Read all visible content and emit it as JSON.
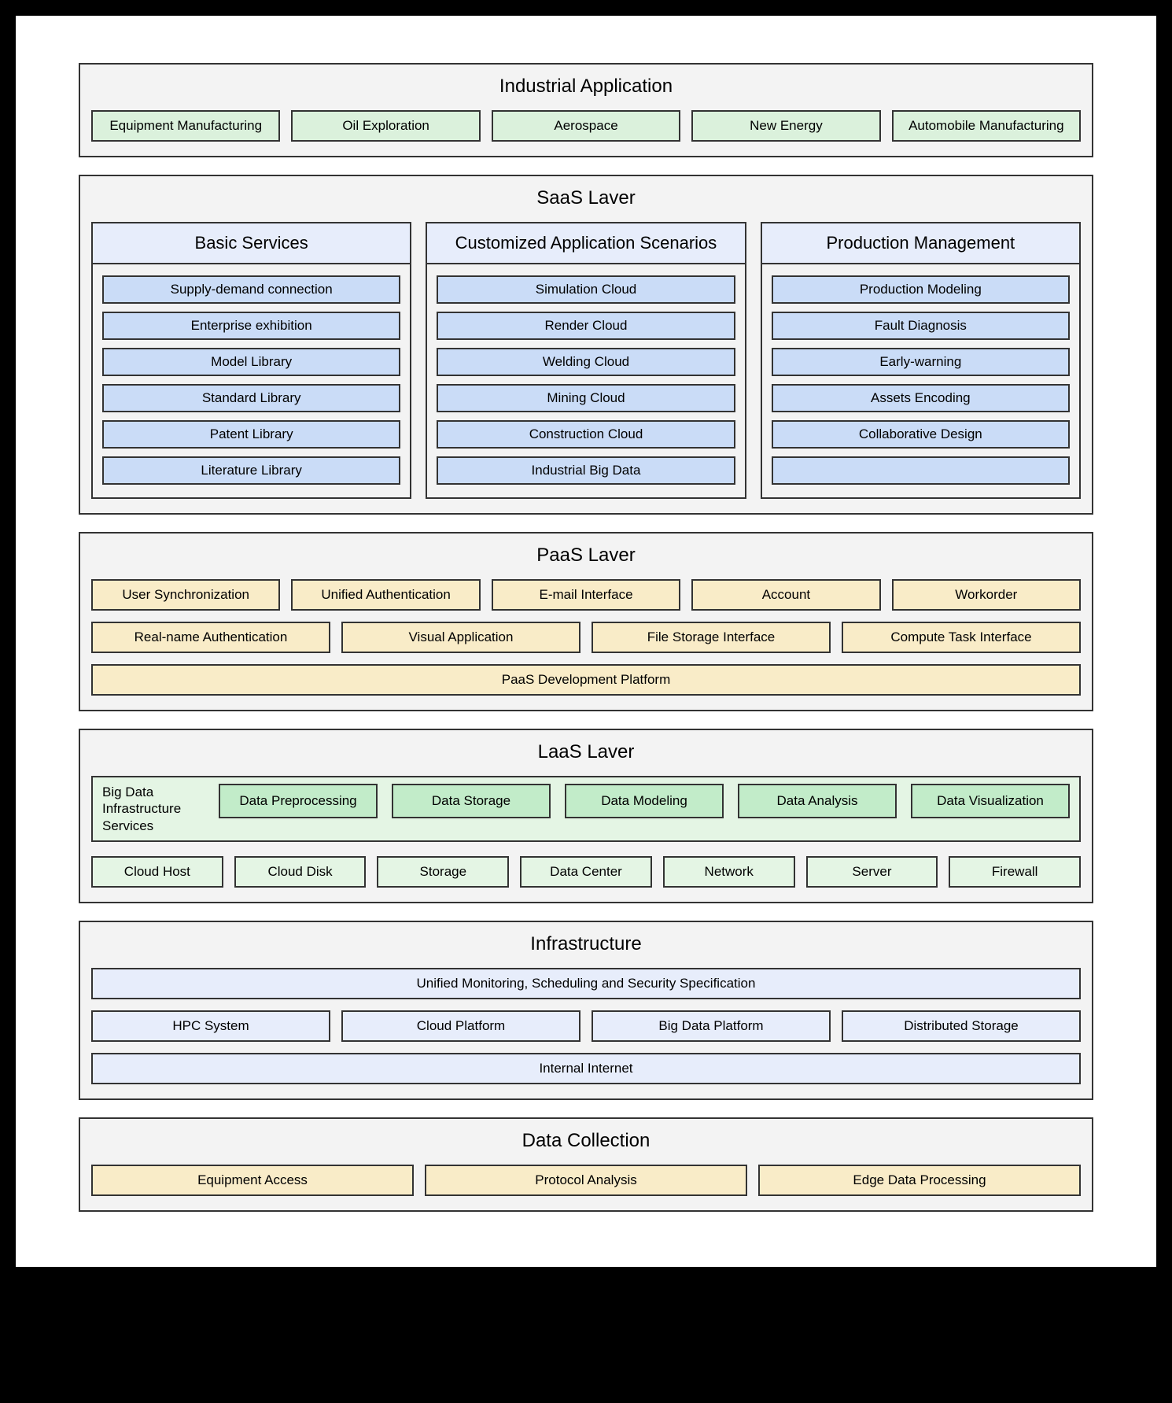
{
  "industrial": {
    "title": "Industrial Application",
    "items": [
      "Equipment Manufacturing",
      "Oil Exploration",
      "Aerospace",
      "New Energy",
      "Automobile Manufacturing"
    ]
  },
  "saas": {
    "title": "SaaS Laver",
    "columns": [
      {
        "title": "Basic Services",
        "items": [
          "Supply-demand connection",
          "Enterprise exhibition",
          "Model Library",
          "Standard Library",
          "Patent Library",
          "Literature Library"
        ]
      },
      {
        "title": "Customized Application Scenarios",
        "items": [
          "Simulation Cloud",
          "Render Cloud",
          "Welding Cloud",
          "Mining Cloud",
          "Construction Cloud",
          "Industrial Big Data"
        ]
      },
      {
        "title": "Production Management",
        "items": [
          "Production Modeling",
          "Fault Diagnosis",
          "Early-warning",
          "Assets Encoding",
          "Collaborative Design",
          ""
        ]
      }
    ]
  },
  "paas": {
    "title": "PaaS Laver",
    "row1": [
      "User Synchronization",
      "Unified Authentication",
      "E-mail Interface",
      "Account",
      "Workorder"
    ],
    "row2": [
      "Real-name Authentication",
      "Visual Application",
      "File Storage Interface",
      "Compute Task Interface"
    ],
    "bottom": "PaaS Development Platform"
  },
  "laas": {
    "title": "LaaS Laver",
    "bigdata_label": "Big Data Infrastructure Services",
    "bigdata_items": [
      "Data Preprocessing",
      "Data Storage",
      "Data Modeling",
      "Data Analysis",
      "Data Visualization"
    ],
    "row2": [
      "Cloud Host",
      "Cloud Disk",
      "Storage",
      "Data Center",
      "Network",
      "Server",
      "Firewall"
    ]
  },
  "infra": {
    "title": "Infrastructure",
    "top": "Unified Monitoring, Scheduling and Security Specification",
    "row": [
      "HPC System",
      "Cloud Platform",
      "Big Data Platform",
      "Distributed Storage"
    ],
    "bottom": "Internal Internet"
  },
  "datacollection": {
    "title": "Data Collection",
    "items": [
      "Equipment Access",
      "Protocol Analysis",
      "Edge Data Processing"
    ]
  }
}
